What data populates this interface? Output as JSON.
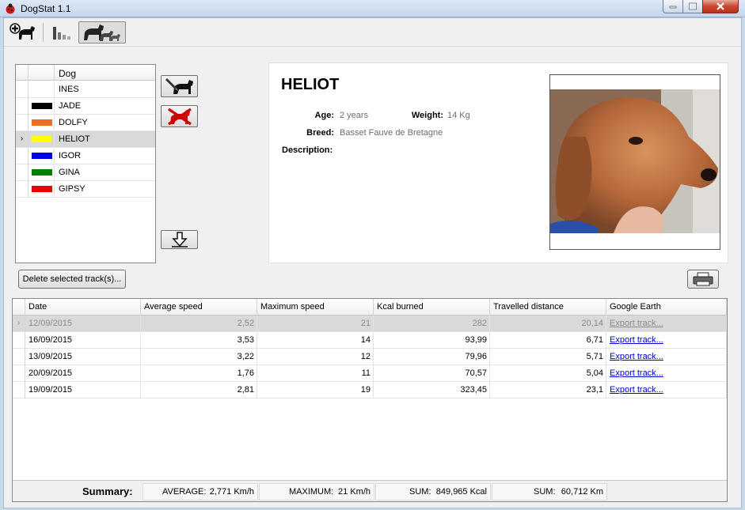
{
  "window": {
    "title": "DogStat 1.1"
  },
  "toolbar": {
    "items": [
      "add-dog",
      "statistics",
      "dogs"
    ]
  },
  "dog_list": {
    "header": "Dog",
    "rows": [
      {
        "name": "INES",
        "color": "#ffffff"
      },
      {
        "name": "JADE",
        "color": "#000000"
      },
      {
        "name": "DOLFY",
        "color": "#f07020"
      },
      {
        "name": "HELIOT",
        "color": "#ffff00",
        "selected": true
      },
      {
        "name": "IGOR",
        "color": "#0000ee"
      },
      {
        "name": "GINA",
        "color": "#008000"
      },
      {
        "name": "GIPSY",
        "color": "#ee0000"
      }
    ]
  },
  "detail": {
    "name": "HELIOT",
    "age_label": "Age:",
    "age": "2 years",
    "weight_label": "Weight:",
    "weight": "14 Kg",
    "breed_label": "Breed:",
    "breed": "Basset Fauve de Bretagne",
    "description_label": "Description:"
  },
  "actions": {
    "delete_tracks": "Delete selected track(s)..."
  },
  "tracks": {
    "columns": [
      "Date",
      "Average speed",
      "Maximum speed",
      "Kcal burned",
      "Travelled distance",
      "Google Earth"
    ],
    "rows": [
      {
        "date": "12/09/2015",
        "avg": "2,52",
        "max": "21",
        "kcal": "282",
        "dist": "20,14",
        "export": "Export track...",
        "selected": true
      },
      {
        "date": "16/09/2015",
        "avg": "3,53",
        "max": "14",
        "kcal": "93,99",
        "dist": "6,71",
        "export": "Export track..."
      },
      {
        "date": "13/09/2015",
        "avg": "3,22",
        "max": "12",
        "kcal": "79,96",
        "dist": "5,71",
        "export": "Export track..."
      },
      {
        "date": "20/09/2015",
        "avg": "1,76",
        "max": "11",
        "kcal": "70,57",
        "dist": "5,04",
        "export": "Export track..."
      },
      {
        "date": "19/09/2015",
        "avg": "2,81",
        "max": "19",
        "kcal": "323,45",
        "dist": "23,1",
        "export": "Export track..."
      }
    ]
  },
  "summary": {
    "title": "Summary:",
    "average_label": "AVERAGE:",
    "average": "2,771 Km/h",
    "maximum_label": "MAXIMUM:",
    "maximum": "21 Km/h",
    "kcal_label": "SUM:",
    "kcal": "849,965 Kcal",
    "dist_label": "SUM:",
    "dist": "60,712 Km"
  }
}
